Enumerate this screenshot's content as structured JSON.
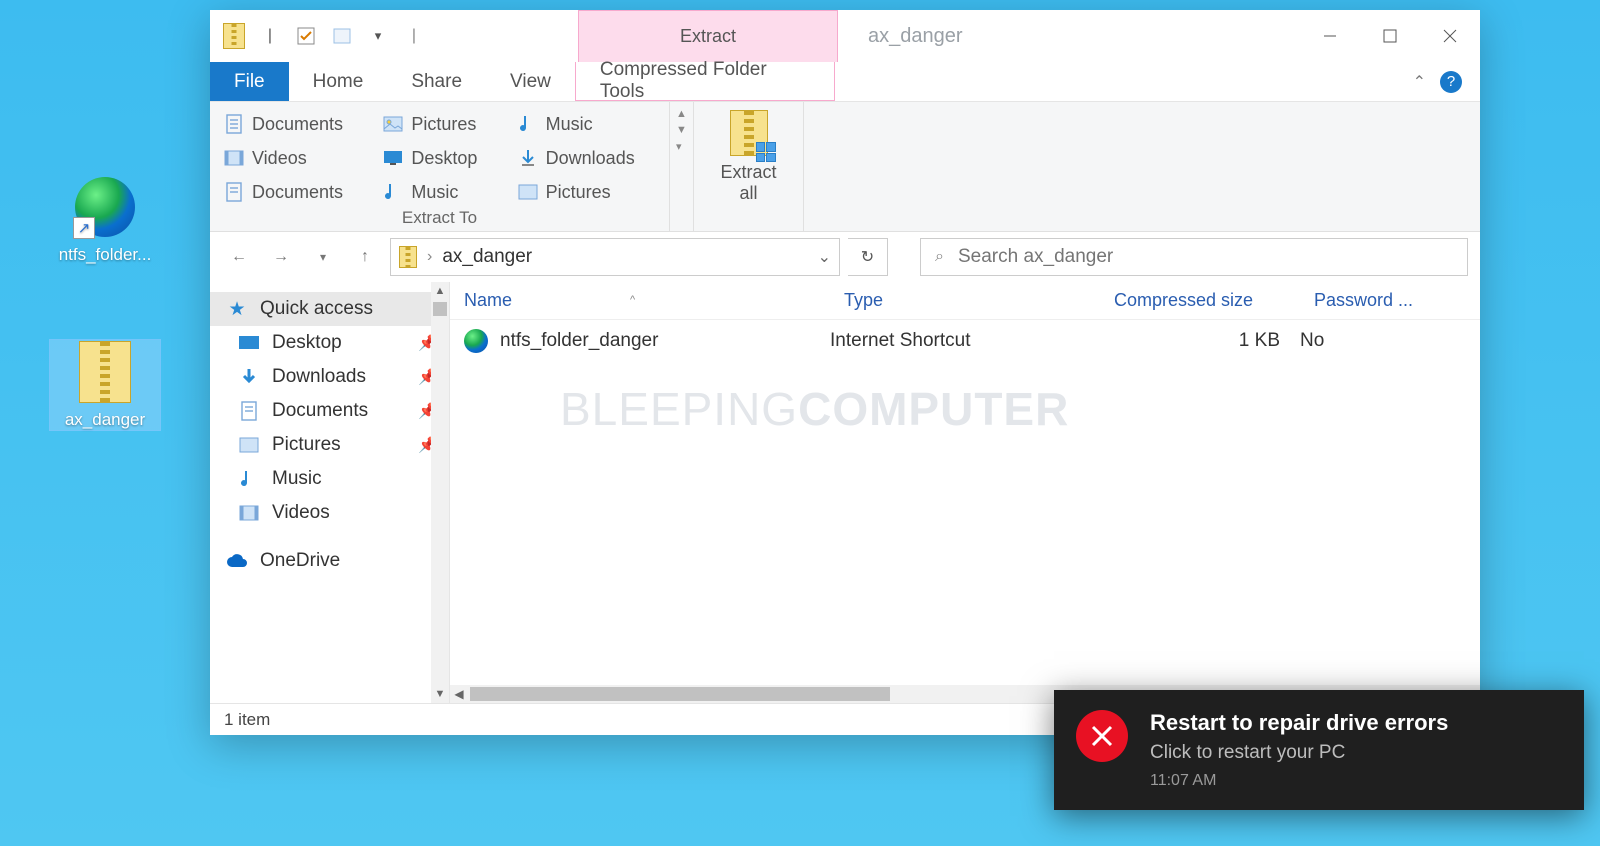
{
  "desktop": {
    "icons": [
      {
        "label": "ntfs_folder...",
        "type": "globe-shortcut"
      },
      {
        "label": "ax_danger",
        "type": "zip",
        "selected": true
      }
    ]
  },
  "window": {
    "context_tab": "Extract",
    "title": "ax_danger",
    "tabs": {
      "file": "File",
      "home": "Home",
      "share": "Share",
      "view": "View",
      "tools": "Compressed Folder Tools"
    },
    "ribbon": {
      "extract_to_caption": "Extract To",
      "items": [
        "Documents",
        "Pictures",
        "Music",
        "Videos",
        "Desktop",
        "Downloads",
        "Documents",
        "Music",
        "Pictures"
      ],
      "extract_all": "Extract\nall"
    },
    "address": {
      "crumb": "ax_danger"
    },
    "search": {
      "placeholder": "Search ax_danger"
    },
    "sidebar": {
      "quick_access": "Quick access",
      "items": [
        "Desktop",
        "Downloads",
        "Documents",
        "Pictures",
        "Music",
        "Videos"
      ],
      "onedrive": "OneDrive"
    },
    "columns": {
      "name": "Name",
      "type": "Type",
      "compressed": "Compressed size",
      "password": "Password ..."
    },
    "rows": [
      {
        "name": "ntfs_folder_danger",
        "type": "Internet Shortcut",
        "compressed": "1 KB",
        "password": "No"
      }
    ],
    "watermark": {
      "a": "BLEEPING",
      "b": "COMPUTER"
    },
    "status": "1 item"
  },
  "toast": {
    "title": "Restart to repair drive errors",
    "subtitle": "Click to restart your PC",
    "time": "11:07 AM"
  }
}
